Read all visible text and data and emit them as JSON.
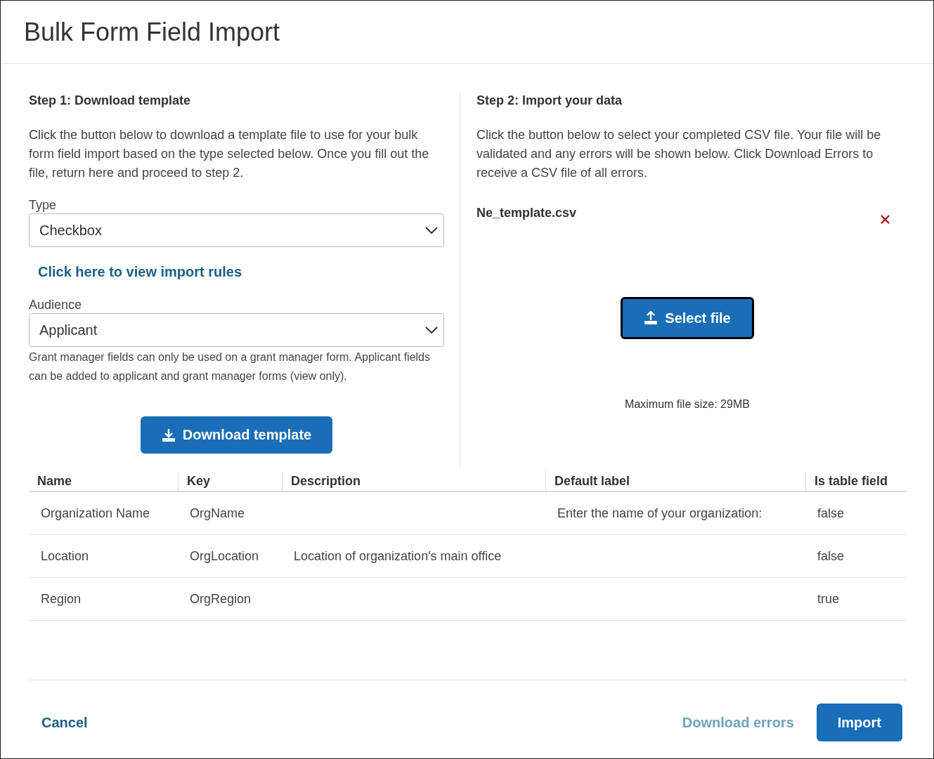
{
  "title": "Bulk Form Field Import",
  "step1": {
    "heading": "Step 1: Download template",
    "description": "Click the button below to download a template file to use for your bulk form field import based on the type selected below. Once you fill out the file, return here and proceed to step 2.",
    "type_field": {
      "label": "Type",
      "value": "Checkbox"
    },
    "rules_link": "Click here to view import rules",
    "audience_field": {
      "label": "Audience",
      "value": "Applicant"
    },
    "audience_help": "Grant manager fields can only be used on a grant manager form. Applicant fields can be added to applicant and grant manager forms (view only).",
    "download_button": "Download template"
  },
  "step2": {
    "heading": "Step 2: Import your data",
    "description": "Click the button below to select your completed CSV file. Your file will be validated and any errors will be shown below. Click Download Errors to receive a CSV file of all errors.",
    "file_name": "Ne_template.csv",
    "select_button": {
      "label": "Select file",
      "focused": true
    },
    "max_size": "Maximum file size: 29MB"
  },
  "table": {
    "columns": [
      "Name",
      "Key",
      "Description",
      "Default label",
      "Is table field"
    ],
    "rows": [
      [
        "Organization Name",
        "OrgName",
        "",
        "Enter the name of your organization:",
        "false"
      ],
      [
        "Location",
        "OrgLocation",
        "Location of organization's main office",
        "",
        "false"
      ],
      [
        "Region",
        "OrgRegion",
        "",
        "",
        "true"
      ]
    ]
  },
  "footer": {
    "cancel": "Cancel",
    "download_errors": {
      "label": "Download errors",
      "disabled": true
    },
    "import": "Import"
  }
}
